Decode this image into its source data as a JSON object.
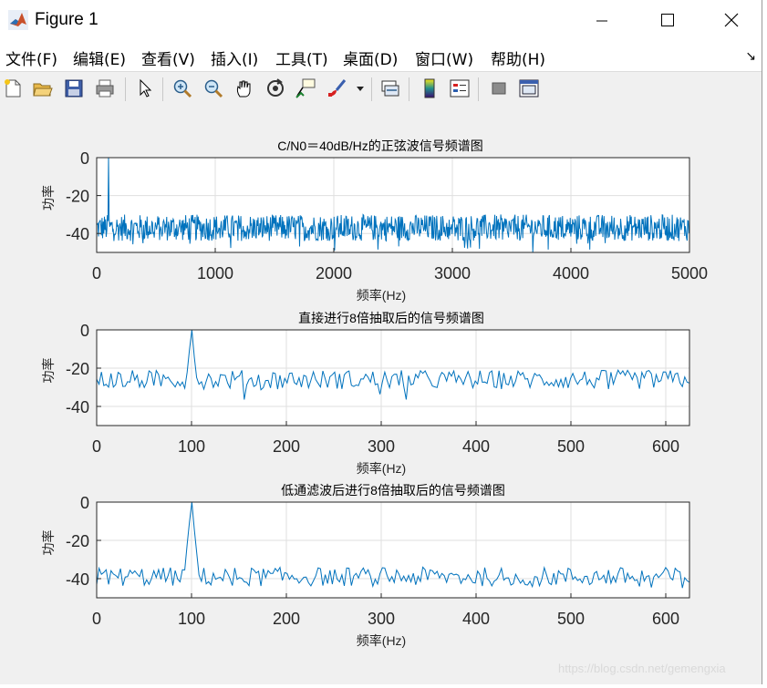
{
  "window": {
    "title": "Figure 1"
  },
  "menu": [
    "文件(F)",
    "编辑(E)",
    "查看(V)",
    "插入(I)",
    "工具(T)",
    "桌面(D)",
    "窗口(W)",
    "帮助(H)"
  ],
  "toolbar": [
    {
      "name": "new-figure-icon"
    },
    {
      "name": "open-file-icon"
    },
    {
      "name": "save-icon"
    },
    {
      "name": "print-icon"
    },
    {
      "name": "pointer-icon"
    },
    {
      "name": "zoom-in-icon"
    },
    {
      "name": "zoom-out-icon"
    },
    {
      "name": "pan-icon"
    },
    {
      "name": "rotate-3d-icon"
    },
    {
      "name": "data-cursor-icon"
    },
    {
      "name": "brush-icon"
    },
    {
      "name": "brush-dropdown-icon"
    },
    {
      "name": "link-plot-icon"
    },
    {
      "name": "insert-colorbar-icon"
    },
    {
      "name": "insert-legend-icon"
    },
    {
      "name": "hide-plot-tools-icon"
    },
    {
      "name": "show-plot-tools-icon"
    }
  ],
  "colors": {
    "line": "#0072bd",
    "grid": "#dfdfdf",
    "axes_bg": "#ffffff"
  },
  "chart_data": [
    {
      "type": "line",
      "title": "C/N0＝40dB/Hz的正弦波信号频谱图",
      "xlabel": "频率(Hz)",
      "ylabel": "功率",
      "xlim": [
        0,
        5000
      ],
      "ylim": [
        -50,
        0
      ],
      "xticks": [
        0,
        1000,
        2000,
        3000,
        4000,
        5000
      ],
      "yticks": [
        0,
        -20,
        -40
      ],
      "grid": true,
      "series": [
        {
          "peak_x": 100,
          "peak_y": 0,
          "noise_mean": -37,
          "noise_spread": 7,
          "points": 1000
        }
      ]
    },
    {
      "type": "line",
      "title": "直接进行8倍抽取后的信号频谱图",
      "xlabel": "频率(Hz)",
      "ylabel": "功率",
      "xlim": [
        0,
        625
      ],
      "ylim": [
        -50,
        0
      ],
      "xticks": [
        0,
        100,
        200,
        300,
        400,
        500,
        600
      ],
      "yticks": [
        0,
        -20,
        -40
      ],
      "grid": true,
      "series": [
        {
          "peak_x": 100,
          "peak_y": 0,
          "noise_mean": -26,
          "noise_spread": 5,
          "points": 250
        }
      ]
    },
    {
      "type": "line",
      "title": "低通滤波后进行8倍抽取后的信号频谱图",
      "xlabel": "频率(Hz)",
      "ylabel": "功率",
      "xlim": [
        0,
        625
      ],
      "ylim": [
        -50,
        0
      ],
      "xticks": [
        0,
        100,
        200,
        300,
        400,
        500,
        600
      ],
      "yticks": [
        0,
        -20,
        -40
      ],
      "grid": true,
      "series": [
        {
          "peak_x": 100,
          "peak_y": 0,
          "noise_mean": -39,
          "noise_spread": 5,
          "points": 250
        }
      ]
    }
  ],
  "watermark": "https://blog.csdn.net/gemengxia"
}
